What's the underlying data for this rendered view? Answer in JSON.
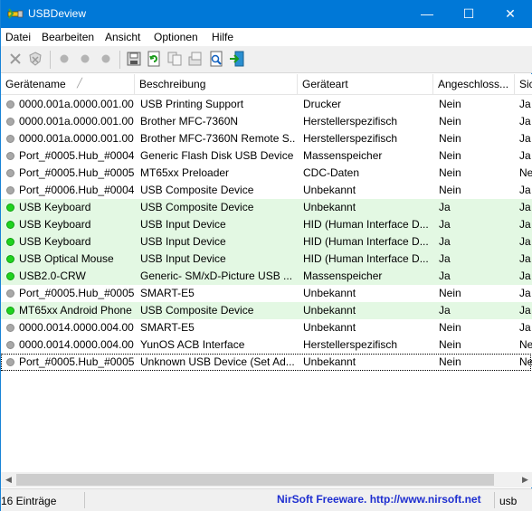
{
  "window": {
    "title": "USBDeview",
    "buttons": {
      "minimize": "—",
      "maximize": "☐",
      "close": "✕"
    }
  },
  "menu": [
    "Datei",
    "Bearbeiten",
    "Ansicht",
    "Optionen",
    "Hilfe"
  ],
  "toolbar": {
    "icons": [
      "disconnect-icon",
      "uninstall-icon",
      "disable-icon",
      "enable-icon",
      "enable-disable-icon",
      "save-icon",
      "refresh-icon",
      "copy-icon",
      "properties-icon",
      "html-report-icon",
      "exit-icon"
    ]
  },
  "columns": [
    "Gerätename",
    "Beschreibung",
    "Geräteart",
    "Angeschloss...",
    "Sic"
  ],
  "rows": [
    {
      "status": "gray",
      "name": "0000.001a.0000.001.00...",
      "desc": "USB Printing Support",
      "type": "Drucker",
      "connected": "Nein",
      "safe": "Ja"
    },
    {
      "status": "gray",
      "name": "0000.001a.0000.001.00...",
      "desc": "Brother MFC-7360N",
      "type": "Herstellerspezifisch",
      "connected": "Nein",
      "safe": "Ja"
    },
    {
      "status": "gray",
      "name": "0000.001a.0000.001.00...",
      "desc": "Brother MFC-7360N Remote S...",
      "type": "Herstellerspezifisch",
      "connected": "Nein",
      "safe": "Ja"
    },
    {
      "status": "gray",
      "name": "Port_#0005.Hub_#0004",
      "desc": "Generic Flash Disk USB Device",
      "type": "Massenspeicher",
      "connected": "Nein",
      "safe": "Ja"
    },
    {
      "status": "gray",
      "name": "Port_#0005.Hub_#0005",
      "desc": "MT65xx Preloader",
      "type": "CDC-Daten",
      "connected": "Nein",
      "safe": "Ne"
    },
    {
      "status": "gray",
      "name": "Port_#0006.Hub_#0004",
      "desc": "USB Composite Device",
      "type": "Unbekannt",
      "connected": "Nein",
      "safe": "Ja"
    },
    {
      "status": "green",
      "name": "USB Keyboard",
      "desc": "USB Composite Device",
      "type": "Unbekannt",
      "connected": "Ja",
      "safe": "Ja"
    },
    {
      "status": "green",
      "name": "USB Keyboard",
      "desc": "USB Input Device",
      "type": "HID (Human Interface D...",
      "connected": "Ja",
      "safe": "Ja"
    },
    {
      "status": "green",
      "name": "USB Keyboard",
      "desc": "USB Input Device",
      "type": "HID (Human Interface D...",
      "connected": "Ja",
      "safe": "Ja"
    },
    {
      "status": "green",
      "name": "USB Optical Mouse",
      "desc": "USB Input Device",
      "type": "HID (Human Interface D...",
      "connected": "Ja",
      "safe": "Ja"
    },
    {
      "status": "green",
      "name": "USB2.0-CRW",
      "desc": "Generic- SM/xD-Picture USB ...",
      "type": "Massenspeicher",
      "connected": "Ja",
      "safe": "Ja"
    },
    {
      "status": "gray",
      "name": "Port_#0005.Hub_#0005",
      "desc": "SMART-E5",
      "type": "Unbekannt",
      "connected": "Nein",
      "safe": "Ja"
    },
    {
      "status": "green",
      "name": "MT65xx Android Phone",
      "desc": "USB Composite Device",
      "type": "Unbekannt",
      "connected": "Ja",
      "safe": "Ja"
    },
    {
      "status": "gray",
      "name": "0000.0014.0000.004.00...",
      "desc": "SMART-E5",
      "type": "Unbekannt",
      "connected": "Nein",
      "safe": "Ja"
    },
    {
      "status": "gray",
      "name": "0000.0014.0000.004.00...",
      "desc": "YunOS ACB Interface",
      "type": "Herstellerspezifisch",
      "connected": "Nein",
      "safe": "Ne"
    },
    {
      "status": "gray",
      "name": "Port_#0005.Hub_#0005",
      "desc": "Unknown USB Device (Set Ad...",
      "type": "Unbekannt",
      "connected": "Nein",
      "safe": "Ne"
    }
  ],
  "status": {
    "count": "16 Einträge",
    "link": "NirSoft Freeware.  http://www.nirsoft.net",
    "filter": "usb"
  },
  "colors": {
    "titlebar": "#0078d7",
    "connected_row": "#e3f8e3",
    "link": "#1f2fd0"
  }
}
